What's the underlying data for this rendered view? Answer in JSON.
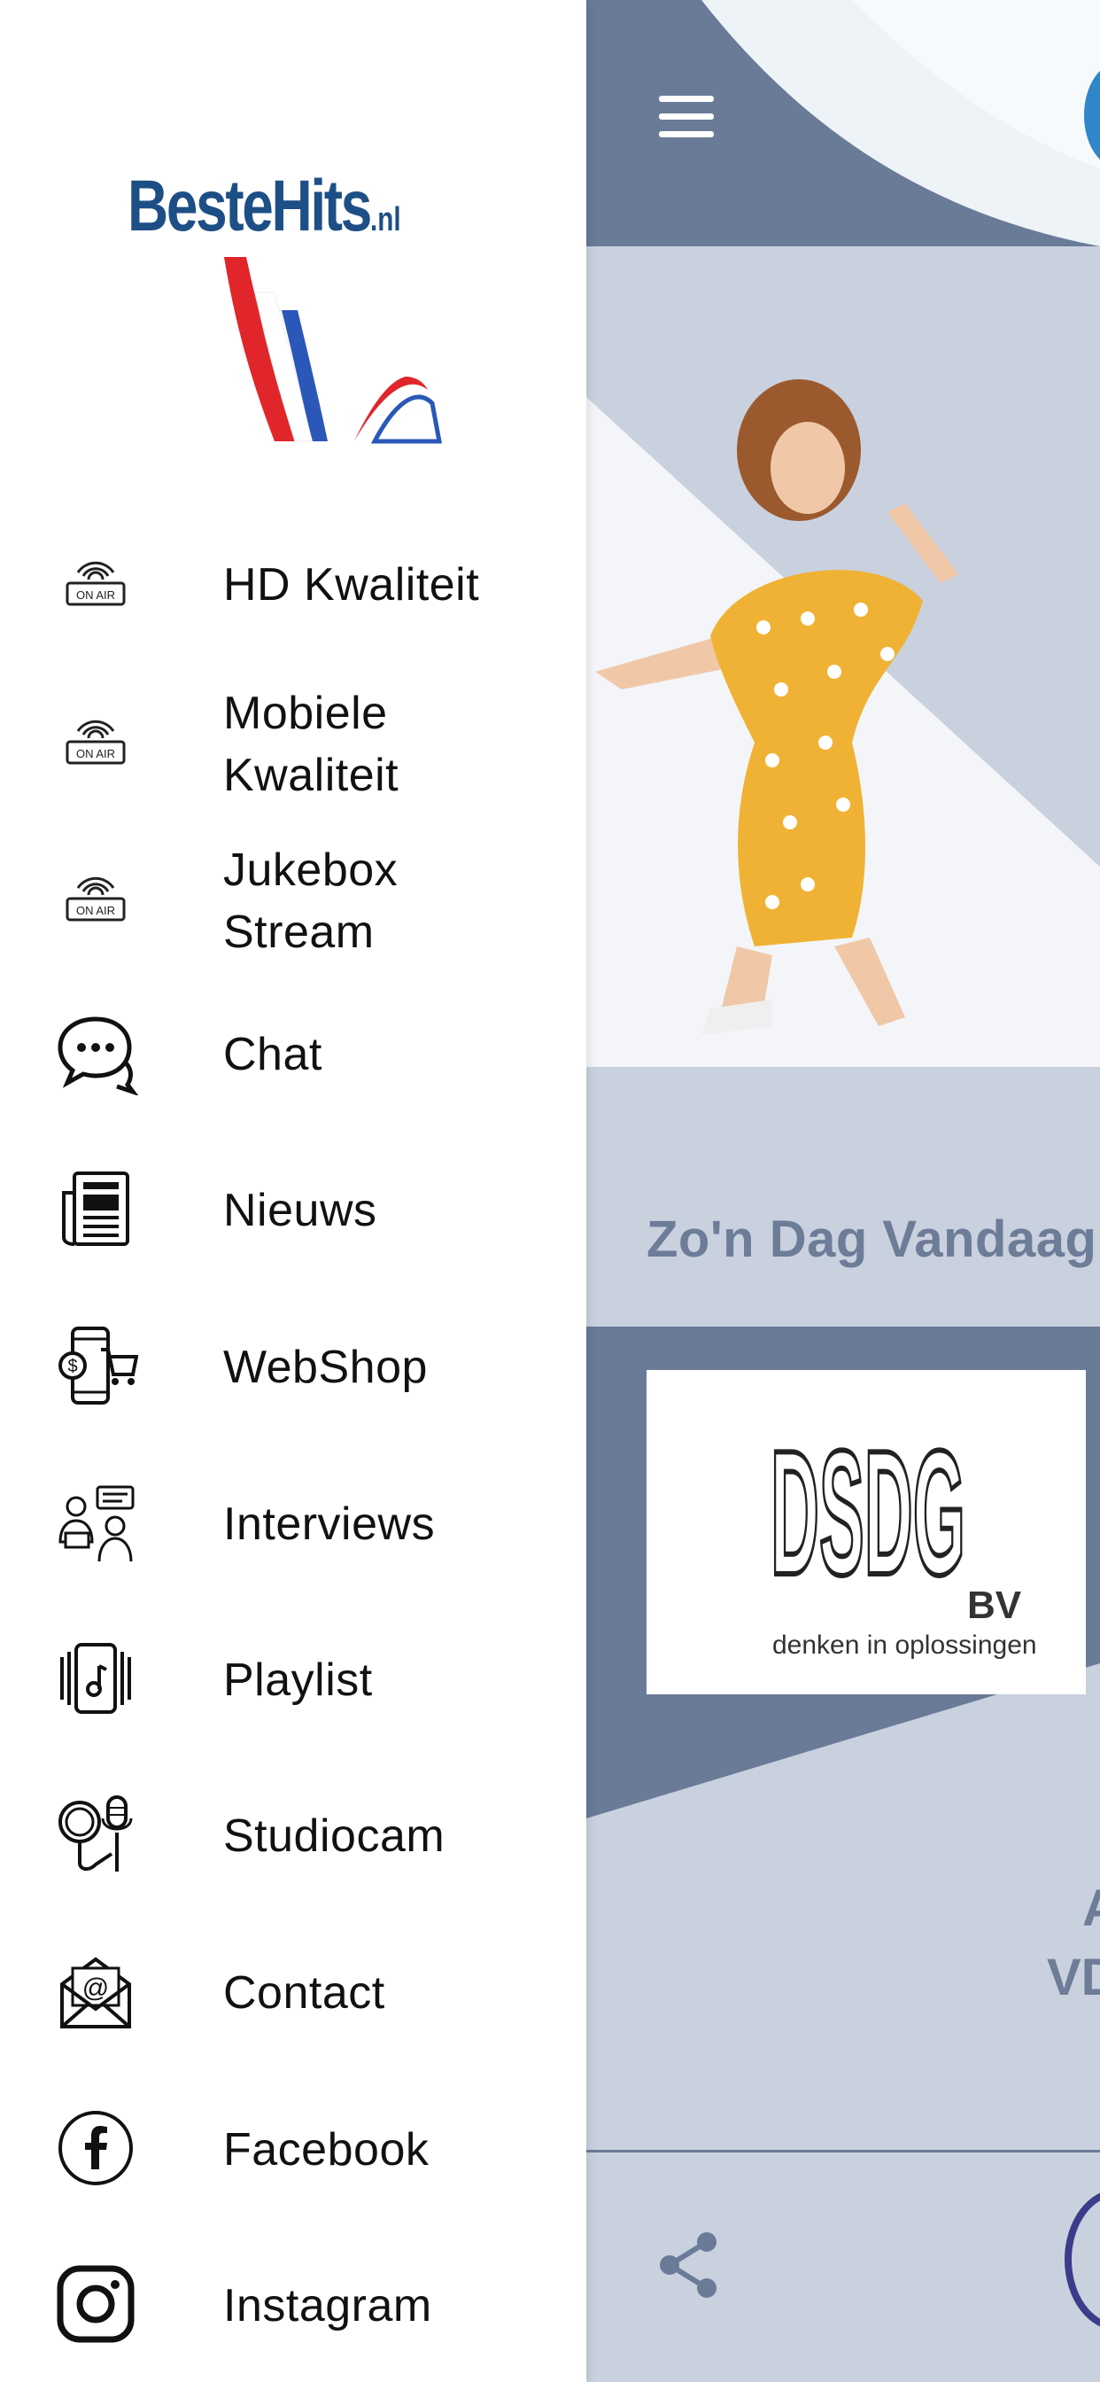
{
  "drawer": {
    "brand": {
      "name": "BesteHits",
      "suffix": ".nl"
    },
    "items": [
      {
        "label": "HD Kwaliteit",
        "icon": "on-air-icon",
        "icon_text": "ON AIR"
      },
      {
        "label": "Mobiele Kwaliteit",
        "icon": "on-air-icon",
        "icon_text": "ON AIR"
      },
      {
        "label": "Jukebox Stream",
        "icon": "on-air-icon",
        "icon_text": "ON AIR"
      },
      {
        "label": "Chat",
        "icon": "chat-bubbles-icon"
      },
      {
        "label": "Nieuws",
        "icon": "newspaper-icon"
      },
      {
        "label": "WebShop",
        "icon": "mobile-shop-icon"
      },
      {
        "label": "Interviews",
        "icon": "interview-icon"
      },
      {
        "label": "Playlist",
        "icon": "music-playlist-icon"
      },
      {
        "label": "Studiocam",
        "icon": "studio-mic-cam-icon"
      },
      {
        "label": "Contact",
        "icon": "envelope-at-icon"
      },
      {
        "label": "Facebook",
        "icon": "facebook-icon"
      },
      {
        "label": "Instagram",
        "icon": "instagram-icon"
      }
    ]
  },
  "main": {
    "section_title": "Zo'n Dag Vandaag",
    "sponsor": {
      "logo_text": "DSDG",
      "suffix": "BV",
      "tagline": "denken in oplossingen"
    },
    "cut_text_1": "A",
    "cut_text_2": "VD"
  },
  "colors": {
    "header": "#6a7b98",
    "background": "#c9d1df",
    "title": "#6d7c97",
    "brand_blue": "#1d4f86",
    "accent_dark": "#3b3d8a"
  }
}
